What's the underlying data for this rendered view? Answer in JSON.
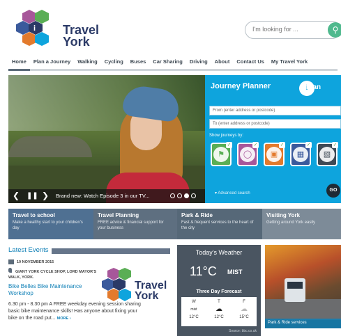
{
  "brand": {
    "line1": "Travel",
    "line2": "York"
  },
  "search": {
    "placeholder": "I'm looking for ...",
    "icon": "search-icon"
  },
  "nav": [
    {
      "label": "Home",
      "active": true
    },
    {
      "label": "Plan a Journey"
    },
    {
      "label": "Walking"
    },
    {
      "label": "Cycling"
    },
    {
      "label": "Buses"
    },
    {
      "label": "Car Sharing"
    },
    {
      "label": "Driving"
    },
    {
      "label": "About"
    },
    {
      "label": "Contact Us"
    },
    {
      "label": "My Travel York"
    }
  ],
  "hero": {
    "caption": "Brand new: Watch Episode 3 in our TV...",
    "dots": 4,
    "active_dot": 2
  },
  "journey_planner": {
    "title": "Journey Planner",
    "brand_label": "Plan",
    "from_placeholder": "From (enter address or postcode)",
    "to_placeholder": "To (enter address or postcode)",
    "show_label": "Show journeys by:",
    "modes": [
      "walking",
      "cycling",
      "car",
      "bus",
      "train"
    ],
    "advanced_label": "Advanced search",
    "go_label": "GO",
    "colors": {
      "walk": "#5aae55",
      "cycle": "#a7579a",
      "car": "#e37a2c",
      "bus": "#3b5a9c",
      "train": "#3f4a55"
    }
  },
  "promos": [
    {
      "title": "Travel to school",
      "text": "Make a healthy start to your children's day",
      "color": "#4f7092"
    },
    {
      "title": "Travel Planning",
      "text": "FREE advice & financial support for your business",
      "color": "#5e6f80"
    },
    {
      "title": "Park & Ride",
      "text": "Fast & frequent services to the heart of the city",
      "color": "#566878"
    },
    {
      "title": "Visiting York",
      "text": "Getting around York easily",
      "color": "#7d8b98"
    }
  ],
  "events": {
    "heading": "Latest Events",
    "date": "10 NOVEMBER 2015",
    "location": "GIANT YORK CYCLE SHOP, LORD MAYOR'S WALK, YORK.",
    "title": "Bike Belles Bike Maintenance Workshop",
    "body": "6.30 pm - 8.30 pm A FREE weekday evening session sharing basic bike maintenance skills! Has anyone about fixing your bike on the road put...",
    "more": "MORE ›"
  },
  "weather": {
    "title": "Today's Weather",
    "temp": "11°C",
    "condition": "MIST",
    "forecast_label": "Three Day Forecast",
    "days": [
      {
        "day": "W",
        "icon": "mist-icon",
        "cond": "mist",
        "temp": "12°C"
      },
      {
        "day": "T",
        "icon": "cloud-icon",
        "cond": "",
        "temp": "12°C"
      },
      {
        "day": "F",
        "icon": "light-cloud-icon",
        "cond": "",
        "temp": "15°C"
      }
    ],
    "source": "Source: bbc.co.uk"
  },
  "park_ride": {
    "caption": "Park & Ride services"
  }
}
